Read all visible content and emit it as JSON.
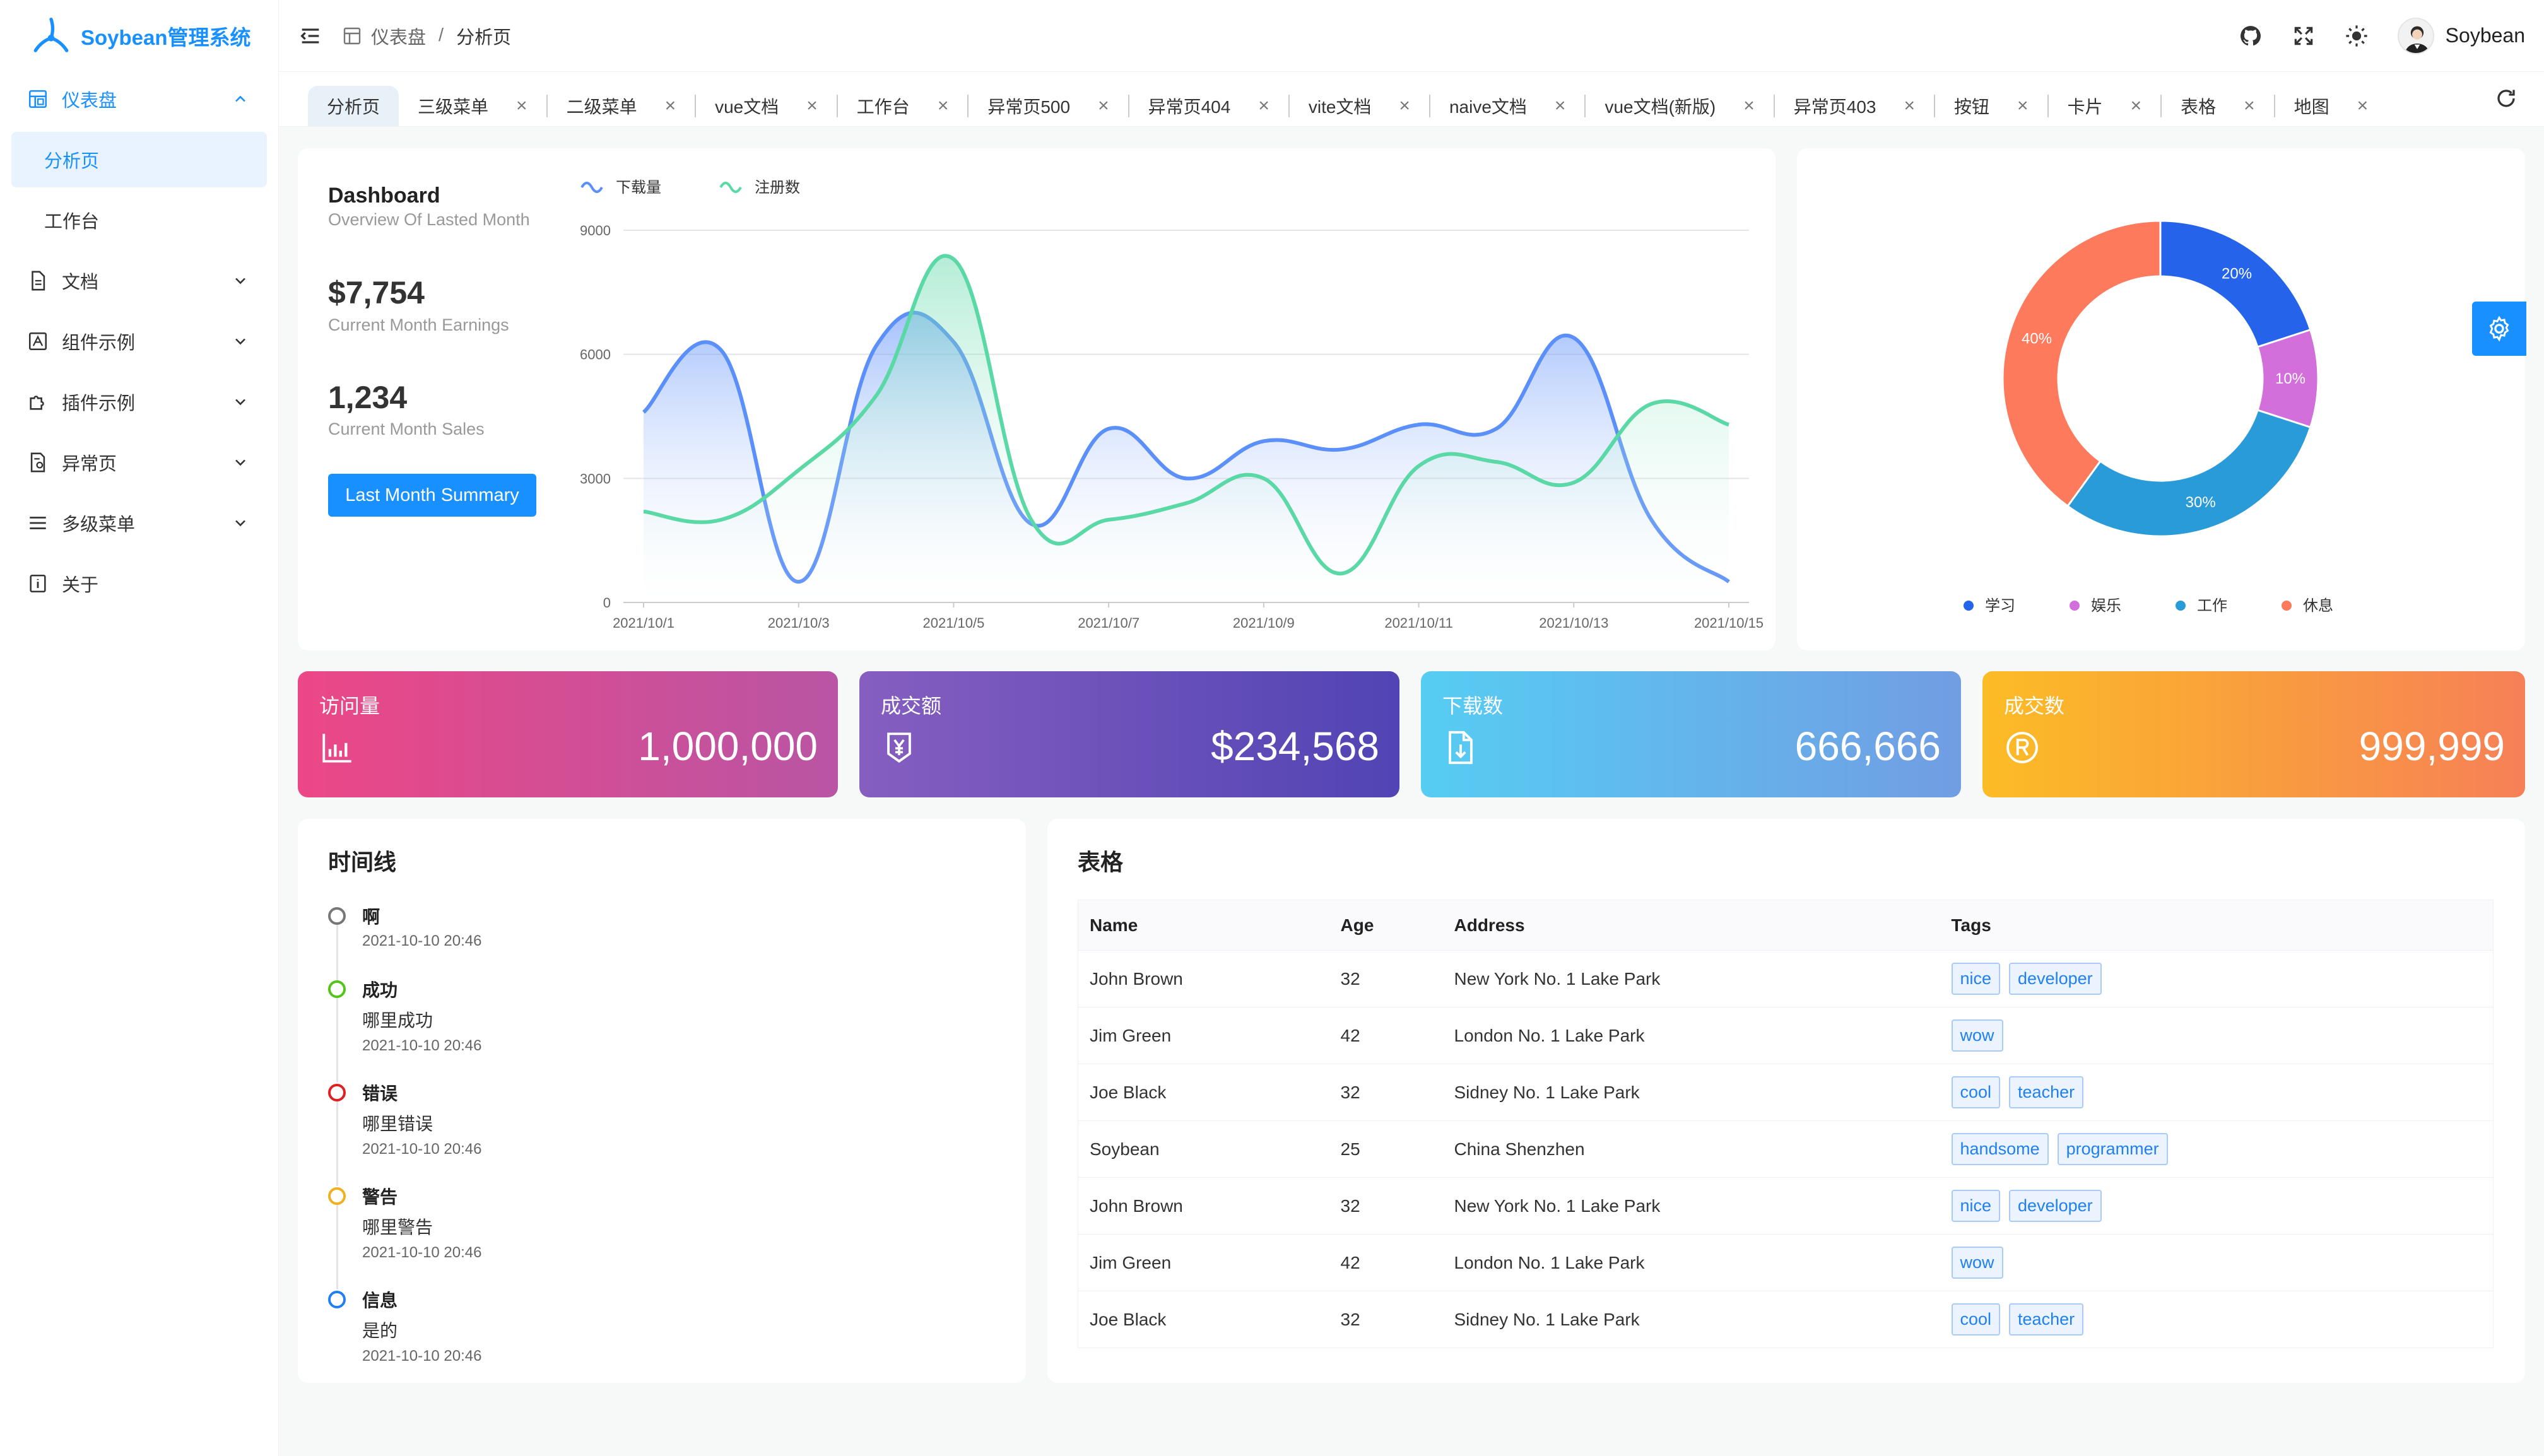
{
  "app": {
    "title": "Soybean管理系统"
  },
  "sidebar": {
    "items": [
      {
        "label": "仪表盘",
        "icon": "dashboard-icon",
        "expanded": true
      },
      {
        "label": "分析页",
        "sub": true,
        "active": true
      },
      {
        "label": "工作台",
        "sub": true
      },
      {
        "label": "文档",
        "icon": "document-icon"
      },
      {
        "label": "组件示例",
        "icon": "component-icon"
      },
      {
        "label": "插件示例",
        "icon": "plugin-icon"
      },
      {
        "label": "异常页",
        "icon": "exception-icon"
      },
      {
        "label": "多级菜单",
        "icon": "menu-list-icon"
      },
      {
        "label": "关于",
        "icon": "about-icon"
      }
    ]
  },
  "header": {
    "breadcrumb": [
      "仪表盘",
      "分析页"
    ],
    "separator": "/",
    "username": "Soybean"
  },
  "tabs": [
    {
      "label": "分析页",
      "active": true,
      "closable": false
    },
    {
      "label": "三级菜单",
      "closable": true
    },
    {
      "label": "二级菜单",
      "closable": true
    },
    {
      "label": "vue文档",
      "closable": true
    },
    {
      "label": "工作台",
      "closable": true
    },
    {
      "label": "异常页500",
      "closable": true
    },
    {
      "label": "异常页404",
      "closable": true
    },
    {
      "label": "vite文档",
      "closable": true
    },
    {
      "label": "naive文档",
      "closable": true
    },
    {
      "label": "vue文档(新版)",
      "closable": true
    },
    {
      "label": "异常页403",
      "closable": true
    },
    {
      "label": "按钮",
      "closable": true
    },
    {
      "label": "卡片",
      "closable": true
    },
    {
      "label": "表格",
      "closable": true
    },
    {
      "label": "地图",
      "closable": true
    }
  ],
  "tab_close_symbol": "×",
  "dashboard": {
    "title": "Dashboard",
    "subtitle": "Overview Of Lasted Month",
    "earnings": "$7,754",
    "earnings_label": "Current Month Earnings",
    "sales": "1,234",
    "sales_label": "Current Month Sales",
    "button": "Last Month Summary"
  },
  "chart_data": [
    {
      "type": "area",
      "x": [
        "2021/10/1",
        "2021/10/2",
        "2021/10/3",
        "2021/10/4",
        "2021/10/5",
        "2021/10/6",
        "2021/10/7",
        "2021/10/8",
        "2021/10/9",
        "2021/10/10",
        "2021/10/11",
        "2021/10/12",
        "2021/10/13",
        "2021/10/14",
        "2021/10/15"
      ],
      "xticks": [
        "2021/10/1",
        "2021/10/3",
        "2021/10/5",
        "2021/10/7",
        "2021/10/9",
        "2021/10/11",
        "2021/10/13",
        "2021/10/15"
      ],
      "yticks": [
        0,
        3000,
        6000,
        9000
      ],
      "ylim": [
        0,
        9000
      ],
      "series": [
        {
          "name": "下载量",
          "color": "#5b8ff9",
          "values": [
            4600,
            6100,
            500,
            6200,
            6300,
            1900,
            4200,
            3000,
            3900,
            3700,
            4300,
            4200,
            6400,
            2000,
            500
          ]
        },
        {
          "name": "注册数",
          "color": "#5ad8a6",
          "values": [
            2200,
            2000,
            3200,
            5000,
            8300,
            2000,
            2000,
            2400,
            3000,
            700,
            3300,
            3400,
            2900,
            4800,
            4300
          ]
        }
      ],
      "legend": "top-left",
      "grid": true
    },
    {
      "type": "pie",
      "variant": "donut",
      "slices": [
        {
          "name": "学习",
          "value": 20,
          "label": "20%",
          "color": "#2563eb"
        },
        {
          "name": "娱乐",
          "value": 10,
          "label": "10%",
          "color": "#d26fdb"
        },
        {
          "name": "工作",
          "value": 30,
          "label": "30%",
          "color": "#2a9bd9"
        },
        {
          "name": "休息",
          "value": 40,
          "label": "40%",
          "color": "#fd7a5c"
        }
      ],
      "legend": "bottom"
    }
  ],
  "stats": [
    {
      "label": "访问量",
      "value": "1,000,000",
      "icon": "bar-chart-icon",
      "from": "#ec4786",
      "to": "#b955a4"
    },
    {
      "label": "成交额",
      "value": "$234,568",
      "icon": "money-bag-icon",
      "from": "#865ec0",
      "to": "#5144b4"
    },
    {
      "label": "下载数",
      "value": "666,666",
      "icon": "download-file-icon",
      "from": "#56cdf3",
      "to": "#719de3"
    },
    {
      "label": "成交数",
      "value": "999,999",
      "icon": "registered-icon",
      "from": "#fcbc25",
      "to": "#f68057"
    }
  ],
  "timeline": {
    "title": "时间线",
    "items": [
      {
        "title": "啊",
        "content": "",
        "time": "2021-10-10 20:46",
        "color": "#777777"
      },
      {
        "title": "成功",
        "content": "哪里成功",
        "time": "2021-10-10 20:46",
        "color": "#52c41a"
      },
      {
        "title": "错误",
        "content": "哪里错误",
        "time": "2021-10-10 20:46",
        "color": "#e02020"
      },
      {
        "title": "警告",
        "content": "哪里警告",
        "time": "2021-10-10 20:46",
        "color": "#f0b020"
      },
      {
        "title": "信息",
        "content": "是的",
        "time": "2021-10-10 20:46",
        "color": "#2080f0"
      }
    ]
  },
  "table": {
    "title": "表格",
    "columns": [
      "Name",
      "Age",
      "Address",
      "Tags"
    ],
    "rows": [
      {
        "name": "John Brown",
        "age": "32",
        "address": "New York No. 1 Lake Park",
        "tags": [
          "nice",
          "developer"
        ]
      },
      {
        "name": "Jim Green",
        "age": "42",
        "address": "London No. 1 Lake Park",
        "tags": [
          "wow"
        ]
      },
      {
        "name": "Joe Black",
        "age": "32",
        "address": "Sidney No. 1 Lake Park",
        "tags": [
          "cool",
          "teacher"
        ]
      },
      {
        "name": "Soybean",
        "age": "25",
        "address": "China Shenzhen",
        "tags": [
          "handsome",
          "programmer"
        ]
      },
      {
        "name": "John Brown",
        "age": "32",
        "address": "New York No. 1 Lake Park",
        "tags": [
          "nice",
          "developer"
        ]
      },
      {
        "name": "Jim Green",
        "age": "42",
        "address": "London No. 1 Lake Park",
        "tags": [
          "wow"
        ]
      },
      {
        "name": "Joe Black",
        "age": "32",
        "address": "Sidney No. 1 Lake Park",
        "tags": [
          "cool",
          "teacher"
        ]
      }
    ]
  }
}
